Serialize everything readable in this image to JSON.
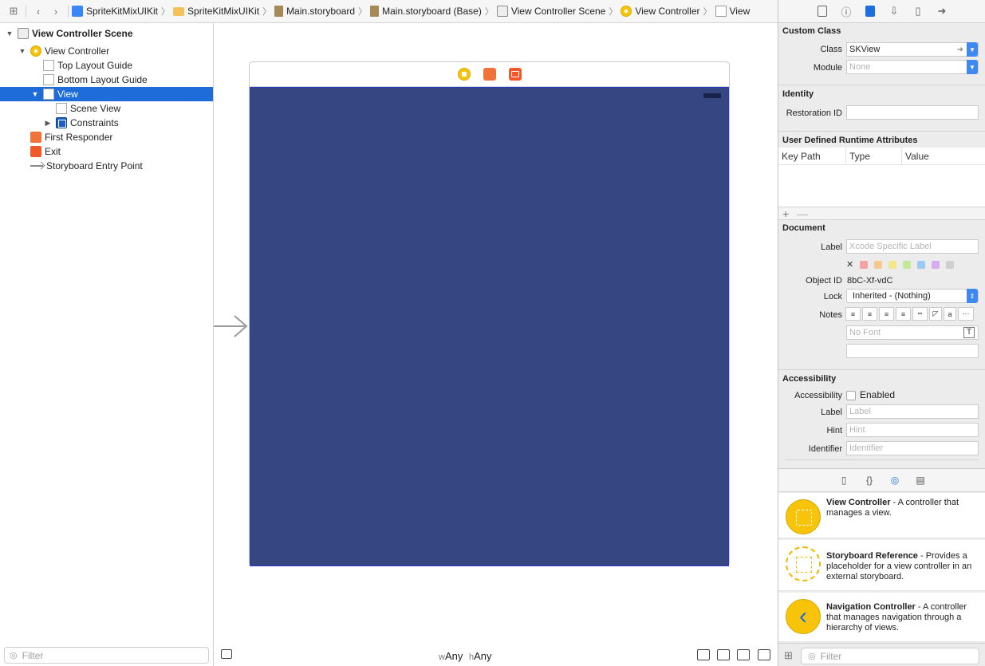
{
  "jumpbar": {
    "crumbs": [
      "SpriteKitMixUIKit",
      "SpriteKitMixUIKit",
      "Main.storyboard",
      "Main.storyboard (Base)",
      "View Controller Scene",
      "View Controller",
      "View"
    ]
  },
  "outline": {
    "rows": [
      "View Controller Scene",
      "View Controller",
      "Top Layout Guide",
      "Bottom Layout Guide",
      "View",
      "Scene View",
      "Constraints",
      "First Responder",
      "Exit",
      "Storyboard Entry Point"
    ],
    "filter_placeholder": "Filter"
  },
  "canvas": {
    "size_class_w_prefix": "w",
    "size_class_w": "Any",
    "size_class_h_prefix": "h",
    "size_class_h": "Any",
    "view_color": "#354683"
  },
  "inspector": {
    "custom_class": {
      "title": "Custom Class",
      "class_label": "Class",
      "class_value": "SKView",
      "module_label": "Module",
      "module_placeholder": "None"
    },
    "identity": {
      "title": "Identity",
      "restoration_id_label": "Restoration ID"
    },
    "udra": {
      "title": "User Defined Runtime Attributes",
      "col_key_path": "Key Path",
      "col_type": "Type",
      "col_value": "Value",
      "add": "+",
      "remove": "—"
    },
    "document": {
      "title": "Document",
      "label_label": "Label",
      "label_placeholder": "Xcode Specific Label",
      "swatch_clear": "✕",
      "object_id_label": "Object ID",
      "object_id_value": "8bC-Xf-vdC",
      "lock_label": "Lock",
      "lock_value": "Inherited - (Nothing)",
      "notes_label": "Notes",
      "font_placeholder": "No Font"
    },
    "accessibility": {
      "title": "Accessibility",
      "accessibility_label": "Accessibility",
      "enabled_label": "Enabled",
      "label_label": "Label",
      "label_placeholder": "Label",
      "hint_label": "Hint",
      "hint_placeholder": "Hint",
      "identifier_label": "Identifier",
      "identifier_placeholder": "Identifier"
    }
  },
  "library": {
    "items": [
      {
        "title": "View Controller",
        "desc": " - A controller that manages a view."
      },
      {
        "title": "Storyboard Reference",
        "desc": " - Provides a placeholder for a view controller in an external storyboard."
      },
      {
        "title": "Navigation Controller",
        "desc": " - A controller that manages navigation through a hierarchy of views."
      }
    ],
    "filter_placeholder": "Filter"
  }
}
